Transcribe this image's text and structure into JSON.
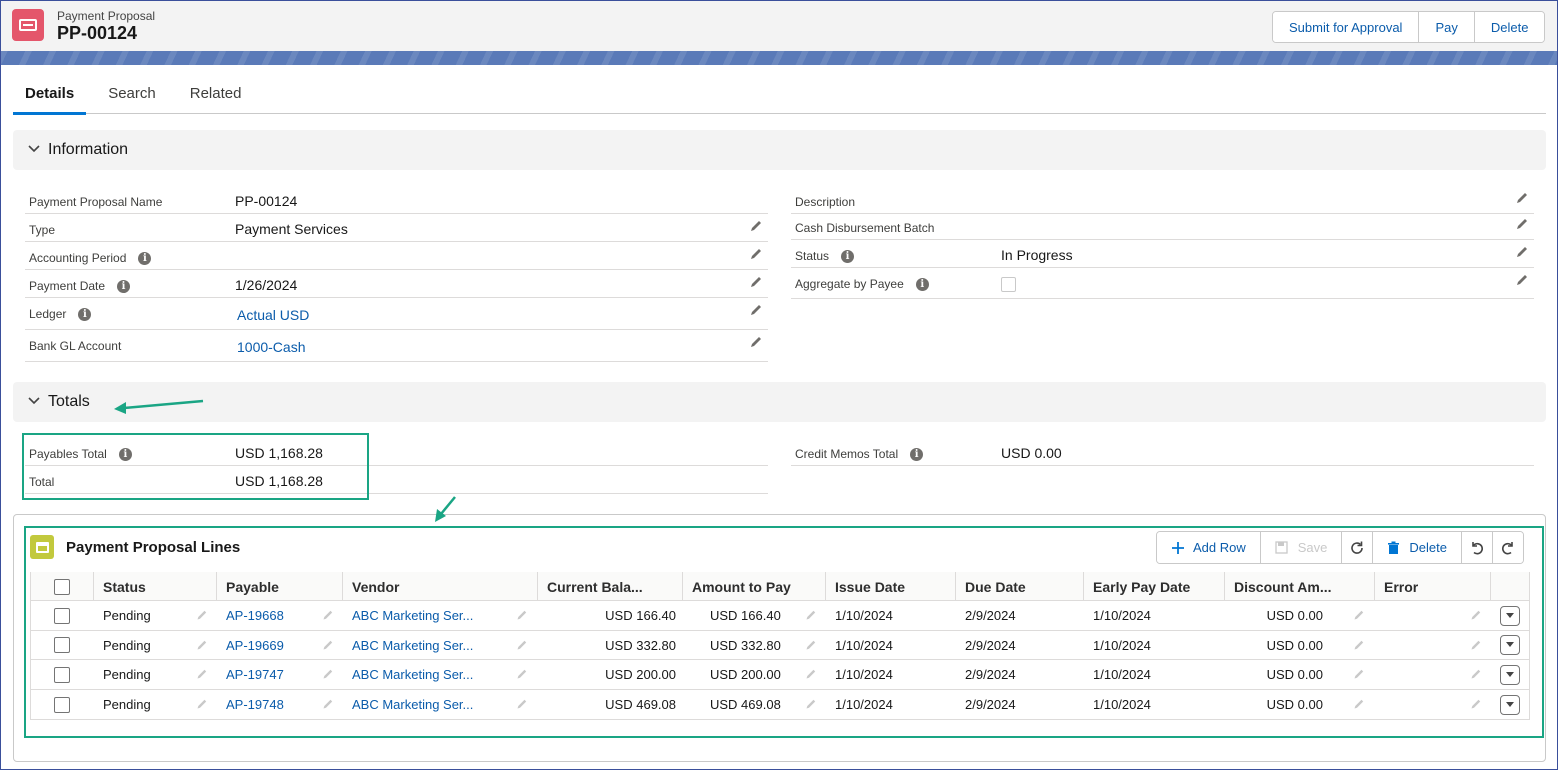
{
  "header": {
    "object_label": "Payment Proposal",
    "record_name": "PP-00124",
    "actions": [
      "Submit for Approval",
      "Pay",
      "Delete"
    ]
  },
  "tabs": [
    "Details",
    "Search",
    "Related"
  ],
  "active_tab": "Details",
  "information": {
    "section_title": "Information",
    "left": [
      {
        "label": "Payment Proposal Name",
        "value": "PP-00124"
      },
      {
        "label": "Type",
        "value": "Payment Services"
      },
      {
        "label": "Accounting Period",
        "value": ""
      },
      {
        "label": "Payment Date",
        "value": "1/26/2024"
      },
      {
        "label": "Ledger",
        "value": "Actual USD"
      },
      {
        "label": "Bank GL Account",
        "value": "1000-Cash"
      }
    ],
    "right": [
      {
        "label": "Description",
        "value": ""
      },
      {
        "label": "Cash Disbursement Batch",
        "value": ""
      },
      {
        "label": "Status",
        "value": "In Progress"
      },
      {
        "label": "Aggregate by Payee",
        "value": ""
      }
    ]
  },
  "totals": {
    "section_title": "Totals",
    "payables_total_label": "Payables Total",
    "payables_total": "USD 1,168.28",
    "total_label": "Total",
    "total": "USD 1,168.28",
    "credit_memos_label": "Credit Memos Total",
    "credit_memos_total": "USD 0.00"
  },
  "lines": {
    "title": "Payment Proposal Lines",
    "toolbar": {
      "add_row": "Add Row",
      "save": "Save",
      "delete": "Delete"
    },
    "columns": [
      "Status",
      "Payable",
      "Vendor",
      "Current Bala...",
      "Amount to Pay",
      "Issue Date",
      "Due Date",
      "Early Pay Date",
      "Discount Am...",
      "Error"
    ],
    "rows": [
      {
        "status": "Pending",
        "payable": "AP-19668",
        "vendor": "ABC Marketing Ser...",
        "balance": "USD 166.40",
        "amount": "USD 166.40",
        "issue": "1/10/2024",
        "due": "2/9/2024",
        "early": "1/10/2024",
        "discount": "USD 0.00",
        "error": ""
      },
      {
        "status": "Pending",
        "payable": "AP-19669",
        "vendor": "ABC Marketing Ser...",
        "balance": "USD 332.80",
        "amount": "USD 332.80",
        "issue": "1/10/2024",
        "due": "2/9/2024",
        "early": "1/10/2024",
        "discount": "USD 0.00",
        "error": ""
      },
      {
        "status": "Pending",
        "payable": "AP-19747",
        "vendor": "ABC Marketing Ser...",
        "balance": "USD 200.00",
        "amount": "USD 200.00",
        "issue": "1/10/2024",
        "due": "2/9/2024",
        "early": "1/10/2024",
        "discount": "USD 0.00",
        "error": ""
      },
      {
        "status": "Pending",
        "payable": "AP-19748",
        "vendor": "ABC Marketing Ser...",
        "balance": "USD 469.08",
        "amount": "USD 469.08",
        "issue": "1/10/2024",
        "due": "2/9/2024",
        "early": "1/10/2024",
        "discount": "USD 0.00",
        "error": ""
      }
    ]
  },
  "colors": {
    "brand": "#0176d3",
    "link": "#0b5cab",
    "record_icon": "#e4566b",
    "lines_icon": "#c2c93d",
    "highlight": "#1aa584"
  }
}
